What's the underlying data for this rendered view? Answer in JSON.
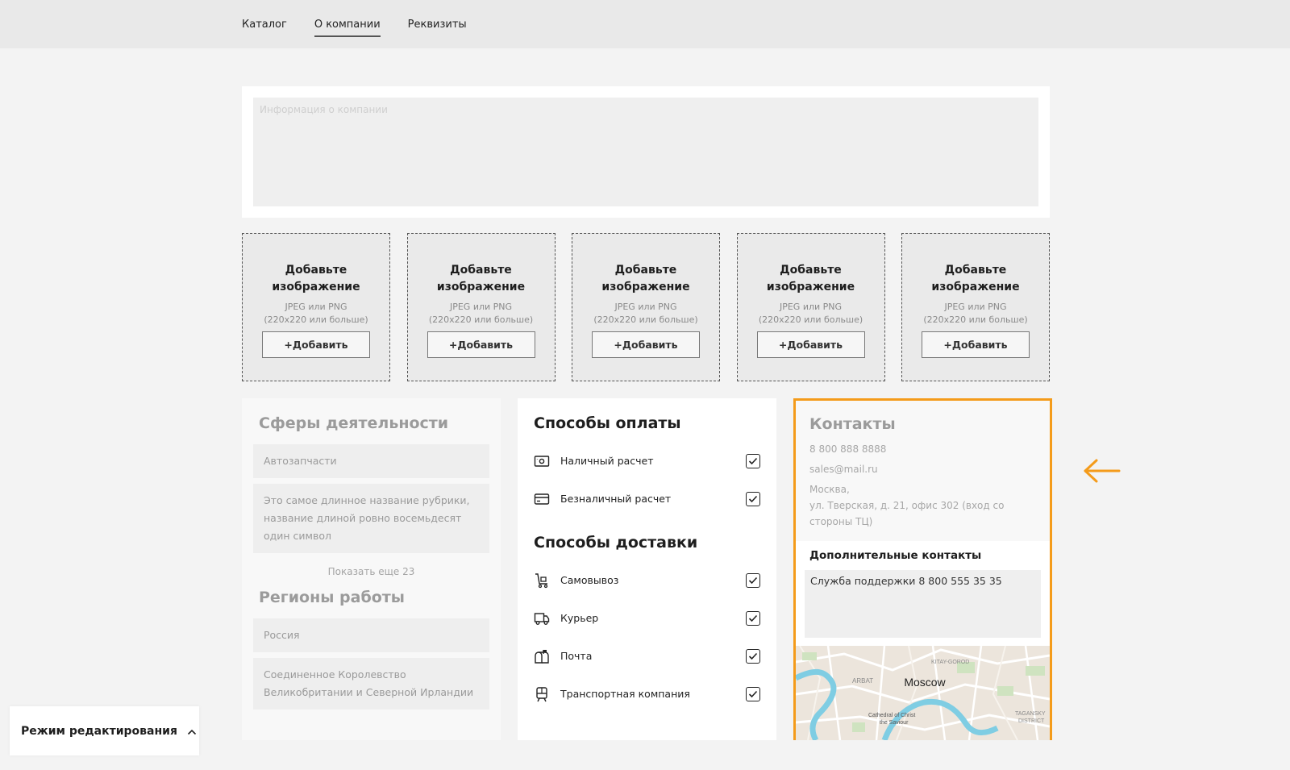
{
  "nav": {
    "items": [
      {
        "label": "Каталог",
        "active": false
      },
      {
        "label": "О компании",
        "active": true
      },
      {
        "label": "Реквизиты",
        "active": false
      }
    ]
  },
  "info": {
    "placeholder": "Информация о компании"
  },
  "uploads": [
    {
      "title": "Добавьте изображение",
      "hint": "JPEG или PNG\n(220x220 или больше)",
      "button": "+Добавить"
    },
    {
      "title": "Добавьте изображение",
      "hint": "JPEG или PNG\n(220x220 или больше)",
      "button": "+Добавить"
    },
    {
      "title": "Добавьте изображение",
      "hint": "JPEG или PNG\n(220x220 или больше)",
      "button": "+Добавить"
    },
    {
      "title": "Добавьте изображение",
      "hint": "JPEG или PNG\n(220x220 или больше)",
      "button": "+Добавить"
    },
    {
      "title": "Добавьте изображение",
      "hint": "JPEG или PNG\n(220x220 или больше)",
      "button": "+Добавить"
    }
  ],
  "activities": {
    "title": "Сферы деятельности",
    "items": [
      "Автозапчасти",
      "Это самое длинное название рубрики, название длиной ровно восемьдесят один символ"
    ],
    "show_more": "Показать еще 23"
  },
  "regions": {
    "title": "Регионы работы",
    "items": [
      "Россия",
      "Соединенное Королевство Великобритании и Северной Ирландии"
    ]
  },
  "payment": {
    "title": "Способы оплаты",
    "options": [
      {
        "label": "Наличный расчет",
        "icon": "cash-icon",
        "checked": true
      },
      {
        "label": "Безналичный расчет",
        "icon": "card-icon",
        "checked": true
      }
    ]
  },
  "delivery": {
    "title": "Способы доставки",
    "options": [
      {
        "label": "Самовывоз",
        "icon": "pickup-cart-icon",
        "checked": true
      },
      {
        "label": "Курьер",
        "icon": "truck-icon",
        "checked": true
      },
      {
        "label": "Почта",
        "icon": "mailbox-icon",
        "checked": true
      },
      {
        "label": "Транспортная компания",
        "icon": "train-icon",
        "checked": true
      }
    ]
  },
  "contacts": {
    "title": "Контакты",
    "phone": "8 800 888 8888",
    "email": "sales@mail.ru",
    "address_city": "Москва,",
    "address_street": "ул. Тверская, д. 21, офис 302 (вход со стороны ТЦ)",
    "extra_title": "Дополнительные контакты",
    "extra_value": "Служба поддержки 8 800 555 35 35",
    "map": {
      "city": "Moscow",
      "labels": [
        "ARBAT",
        "KITAY-GOROD",
        "Cathedral of Christ",
        "the Saviour",
        "TAGANSKY",
        "DISTRICT"
      ]
    }
  },
  "edit_mode": {
    "label": "Режим редактирования"
  },
  "colors": {
    "highlight": "#f49b1a"
  }
}
